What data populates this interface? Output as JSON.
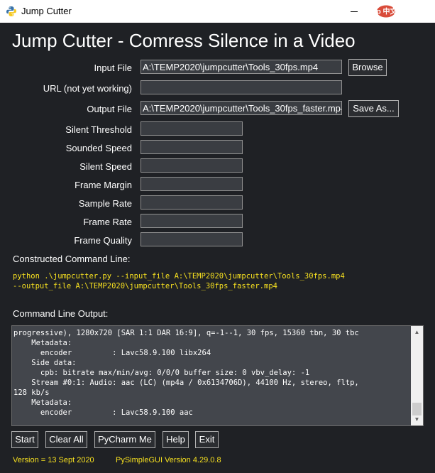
{
  "titlebar": {
    "title": "Jump Cutter",
    "watermark": "php 中文网"
  },
  "main": {
    "heading": "Jump Cutter - Comress Silence in a Video"
  },
  "form": {
    "input_file_label": "Input File",
    "input_file_value": "A:\\TEMP2020\\jumpcutter\\Tools_30fps.mp4",
    "browse_label": "Browse",
    "url_label": "URL (not yet working)",
    "url_value": "",
    "output_file_label": "Output File",
    "output_file_value": "A:\\TEMP2020\\jumpcutter\\Tools_30fps_faster.mp4",
    "save_as_label": "Save As...",
    "params": [
      {
        "label": "Silent Threshold",
        "value": ""
      },
      {
        "label": "Sounded Speed",
        "value": ""
      },
      {
        "label": "Silent Speed",
        "value": ""
      },
      {
        "label": "Frame Margin",
        "value": ""
      },
      {
        "label": "Sample Rate",
        "value": ""
      },
      {
        "label": "Frame Rate",
        "value": ""
      },
      {
        "label": "Frame Quality",
        "value": ""
      }
    ]
  },
  "command": {
    "label": "Constructed Command Line:",
    "text": "python .\\jumpcutter.py --input_file A:\\TEMP2020\\jumpcutter\\Tools_30fps.mp4\n--output_file A:\\TEMP2020\\jumpcutter\\Tools_30fps_faster.mp4"
  },
  "output": {
    "label": "Command Line Output:",
    "text": "progressive), 1280x720 [SAR 1:1 DAR 16:9], q=-1--1, 30 fps, 15360 tbn, 30 tbc\n    Metadata:\n      encoder         : Lavc58.9.100 libx264\n    Side data:\n      cpb: bitrate max/min/avg: 0/0/0 buffer size: 0 vbv_delay: -1\n    Stream #0:1: Audio: aac (LC) (mp4a / 0x6134706D), 44100 Hz, stereo, fltp,\n128 kb/s\n    Metadata:\n      encoder         : Lavc58.9.100 aac"
  },
  "buttons": {
    "start": "Start",
    "clear_all": "Clear All",
    "pycharm": "PyCharm Me",
    "help": "Help",
    "exit": "Exit"
  },
  "footer": {
    "version": "Version = 13 Sept 2020",
    "psg_version": "PySimpleGUI Version 4.29.0.8"
  },
  "colors": {
    "background": "#1f2125",
    "input_bg": "#3a3d42",
    "accent_yellow": "#f6e020",
    "text": "#ffffff"
  }
}
